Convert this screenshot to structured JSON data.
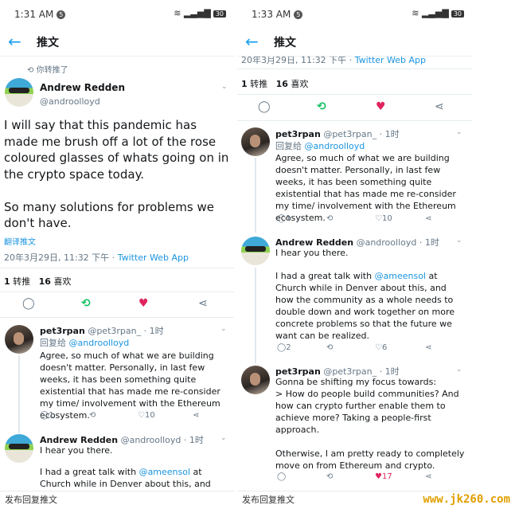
{
  "left": {
    "status": {
      "time": "1:31 AM",
      "notif": "5",
      "battery": "30"
    },
    "header": {
      "title": "推文"
    },
    "retweeted_by": "你转推了",
    "author": {
      "name": "Andrew Redden",
      "handle": "@androolloyd"
    },
    "tweet_text": "I will say that this pandemic has made me brush off a lot of the rose coloured glasses of whats going on in the crypto space today.\n\nSo many solutions for problems we don't have.",
    "translate": "翻译推文",
    "meta": {
      "date": "20年3月29日, 11:32 下午 · ",
      "client": "Twitter Web App"
    },
    "stats": {
      "retweets": "1",
      "retweets_label": "转推",
      "likes": "16",
      "likes_label": "喜欢"
    },
    "reply1": {
      "name": "pet3rpan",
      "handle": "@pet3rpan_",
      "time": "· 1时",
      "reply_to_label": "回复给 ",
      "reply_to": "@androolloyd",
      "text": "Agree, so much of what we are building doesn't matter. Personally, in last few weeks, it has been something quite existential that has made me re-consider my time/ involvement with the Ethereum ecosystem.",
      "replies": "1",
      "likes": "10"
    },
    "reply2": {
      "name": "Andrew Redden",
      "handle": "@androolloyd",
      "time": "· 1时",
      "text1": "I hear you there.",
      "text2a": "I had a great talk with ",
      "mention": "@ameensol",
      "text2b": " at Church while in Denver about this, and how the"
    },
    "bottom": "发布回复推文"
  },
  "right": {
    "status": {
      "time": "1:33 AM",
      "notif": "5",
      "battery": "30"
    },
    "header": {
      "title": "推文"
    },
    "meta": {
      "date": "20年3月29日, 11:32 下午 · ",
      "client": "Twitter Web App"
    },
    "stats": {
      "retweets": "1",
      "retweets_label": "转推",
      "likes": "16",
      "likes_label": "喜欢"
    },
    "reply1": {
      "name": "pet3rpan",
      "handle": "@pet3rpan_",
      "time": "· 1时",
      "reply_to_label": "回复给 ",
      "reply_to": "@androolloyd",
      "text": "Agree, so much of what we are building doesn't matter. Personally, in last few weeks, it has been something quite existential that has made me re-consider my time/ involvement with the Ethereum ecosystem.",
      "replies": "1",
      "likes": "10"
    },
    "reply2": {
      "name": "Andrew Redden",
      "handle": "@androolloyd",
      "time": "· 1时",
      "text1": "I hear you there.",
      "text2a": "I had a great talk with ",
      "mention": "@ameensol",
      "text2b": " at Church while in Denver about this, and how the community as a whole needs to double down and work together on more concrete problems so that the future we want can be realized.",
      "replies": "2",
      "likes": "6"
    },
    "reply3": {
      "name": "pet3rpan",
      "handle": "@pet3rpan_",
      "time": "· 1时",
      "text": "Gonna be shifting my focus towards:\n> How do people build communities? And how can crypto further enable them to achieve more? Taking a people-first approach.\n\nOtherwise, I am pretty ready to completely move on from Ethereum and crypto.",
      "likes": "17"
    },
    "bottom": "发布回复推文"
  },
  "watermark": "www.jk260.com",
  "colors": {
    "accent": "#1da1f2",
    "retweet": "#17bf63",
    "like": "#e0245e"
  }
}
